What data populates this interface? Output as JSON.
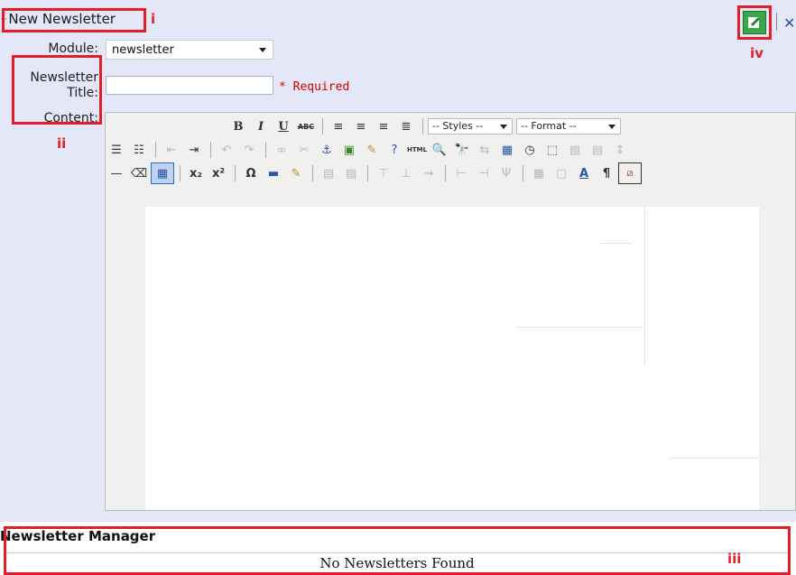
{
  "form": {
    "title": "New Newsletter",
    "module_label": "Module:",
    "module_value": "newsletter",
    "newsletter_title_label_line1": "Newsletter",
    "newsletter_title_label_line2": "Title:",
    "content_label": "Content:",
    "required_text": "* Required"
  },
  "toolbar": {
    "bold": "B",
    "italic": "I",
    "underline": "U",
    "strike": "ABC",
    "styles_dropdown": "-- Styles --",
    "format_dropdown": "-- Format --",
    "html_button": "HTML",
    "omega": "Ω",
    "pilcrow": "¶"
  },
  "annotations": {
    "i": "i",
    "ii": "ii",
    "iii": "iii",
    "iv": "iv"
  },
  "manager": {
    "title": "Newsletter Manager",
    "empty_text": "No Newsletters Found"
  },
  "colors": {
    "panel_bg": "#e3e7f8",
    "annotation": "#e21e26",
    "required": "#d40000"
  }
}
